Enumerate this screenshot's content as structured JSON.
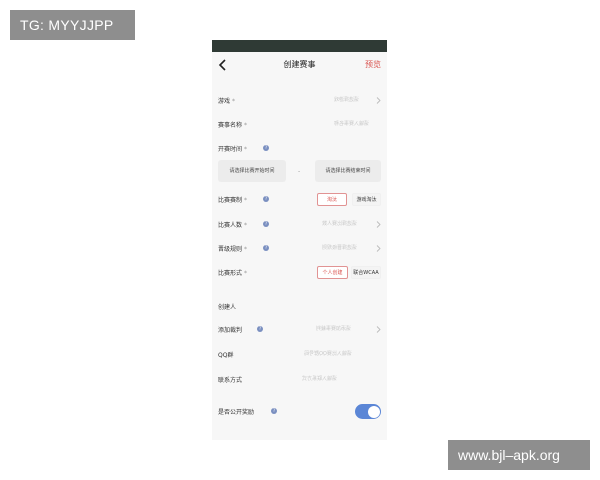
{
  "watermark_top": "TG: MYYJJPP",
  "watermark_bottom": "www.bjl–apk.org",
  "header": {
    "title": "创建赛事",
    "action": "预览"
  },
  "form": {
    "game": {
      "label": "游戏",
      "required": "*",
      "placeholder": "请选择游戏"
    },
    "name": {
      "label": "赛事名称",
      "required": "*",
      "placeholder": "请输入赛事名称"
    },
    "time": {
      "label": "开赛时间",
      "required": "*",
      "start_button": "请选择比赛开始时间",
      "separator": "-",
      "end_button": "请选择比赛结束时间"
    },
    "format": {
      "label": "比赛赛制",
      "required": "*",
      "options": [
        "淘汰",
        "游戏淘汰"
      ],
      "selected": "淘汰"
    },
    "players": {
      "label": "比赛人数",
      "required": "*",
      "placeholder": "请选择比赛人数"
    },
    "advance": {
      "label": "晋级规则",
      "required": "*",
      "placeholder": "请选择晋级规则"
    },
    "mode": {
      "label": "比赛形式",
      "required": "*",
      "options": [
        "个人创建",
        "联合WCAA"
      ],
      "selected": "个人创建"
    },
    "creator": {
      "label": "创建人"
    },
    "referee": {
      "label": "添加裁判",
      "placeholder": "请添加赛事裁判"
    },
    "qq": {
      "label": "QQ群",
      "placeholder": "请输入比赛QQ群号码"
    },
    "contact": {
      "label": "联系方式",
      "placeholder": "请输入联系方式"
    },
    "public_reward": {
      "label": "是否公开奖励",
      "enabled": true
    }
  },
  "colors": {
    "accent": "#d9534f",
    "toggle": "#5b86d6",
    "status_bar": "#2f3a35",
    "help_icon": "#7a8fc0"
  }
}
